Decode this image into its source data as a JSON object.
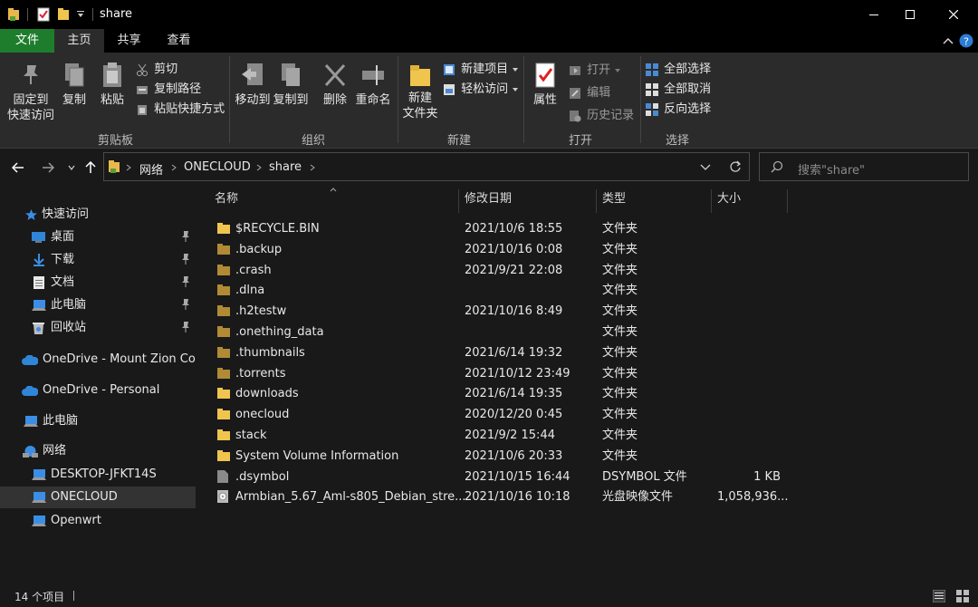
{
  "window": {
    "title": "share"
  },
  "tabs": [
    {
      "label": "文件"
    },
    {
      "label": "主页"
    },
    {
      "label": "共享"
    },
    {
      "label": "查看"
    }
  ],
  "ribbon": {
    "clipboard": {
      "pin_label_1": "固定到",
      "pin_label_2": "快速访问",
      "copy": "复制",
      "paste": "粘贴",
      "cut": "剪切",
      "copy_path": "复制路径",
      "paste_shortcut": "粘贴快捷方式",
      "group": "剪贴板"
    },
    "organize": {
      "move_to": "移动到",
      "copy_to": "复制到",
      "delete": "删除",
      "rename": "重命名",
      "group": "组织"
    },
    "new": {
      "new_item": "新建项目",
      "easy_access": "轻松访问",
      "new_folder_1": "新建",
      "new_folder_2": "文件夹",
      "group": "新建"
    },
    "open": {
      "properties": "属性",
      "open": "打开",
      "edit": "编辑",
      "history": "历史记录",
      "group": "打开"
    },
    "select": {
      "select_all": "全部选择",
      "select_none": "全部取消",
      "invert": "反向选择",
      "group": "选择"
    }
  },
  "address": {
    "crumbs": [
      "网络",
      "ONECLOUD",
      "share"
    ],
    "search_placeholder": "搜索\"share\""
  },
  "nav": {
    "quick_access": "快速访问",
    "items": [
      {
        "label": "桌面"
      },
      {
        "label": "下载"
      },
      {
        "label": "文档"
      },
      {
        "label": "此电脑"
      },
      {
        "label": "回收站"
      }
    ],
    "onedrive_1": "OneDrive - Mount Zion Coll",
    "onedrive_2": "OneDrive - Personal",
    "this_pc": "此电脑",
    "network": "网络",
    "network_items": [
      {
        "label": "DESKTOP-JFKT14S"
      },
      {
        "label": "ONECLOUD"
      },
      {
        "label": "Openwrt"
      }
    ]
  },
  "columns": {
    "name": "名称",
    "date": "修改日期",
    "type": "类型",
    "size": "大小"
  },
  "files": [
    {
      "name": "$RECYCLE.BIN",
      "date": "2021/10/6 18:55",
      "type": "文件夹",
      "size": ""
    },
    {
      "name": ".backup",
      "date": "2021/10/16 0:08",
      "type": "文件夹",
      "size": ""
    },
    {
      "name": ".crash",
      "date": "2021/9/21 22:08",
      "type": "文件夹",
      "size": ""
    },
    {
      "name": ".dlna",
      "date": "",
      "type": "文件夹",
      "size": ""
    },
    {
      "name": ".h2testw",
      "date": "2021/10/16 8:49",
      "type": "文件夹",
      "size": ""
    },
    {
      "name": ".onething_data",
      "date": "",
      "type": "文件夹",
      "size": ""
    },
    {
      "name": ".thumbnails",
      "date": "2021/6/14 19:32",
      "type": "文件夹",
      "size": ""
    },
    {
      "name": ".torrents",
      "date": "2021/10/12 23:49",
      "type": "文件夹",
      "size": ""
    },
    {
      "name": "downloads",
      "date": "2021/6/14 19:35",
      "type": "文件夹",
      "size": ""
    },
    {
      "name": "onecloud",
      "date": "2020/12/20 0:45",
      "type": "文件夹",
      "size": ""
    },
    {
      "name": "stack",
      "date": "2021/9/2 15:44",
      "type": "文件夹",
      "size": ""
    },
    {
      "name": "System Volume Information",
      "date": "2021/10/6 20:33",
      "type": "文件夹",
      "size": ""
    },
    {
      "name": ".dsymbol",
      "date": "2021/10/15 16:44",
      "type": "DSYMBOL 文件",
      "size": "1 KB"
    },
    {
      "name": "Armbian_5.67_Aml-s805_Debian_stre...",
      "date": "2021/10/16 10:18",
      "type": "光盘映像文件",
      "size": "1,058,936..."
    }
  ],
  "status": {
    "count": "14 个项目"
  }
}
